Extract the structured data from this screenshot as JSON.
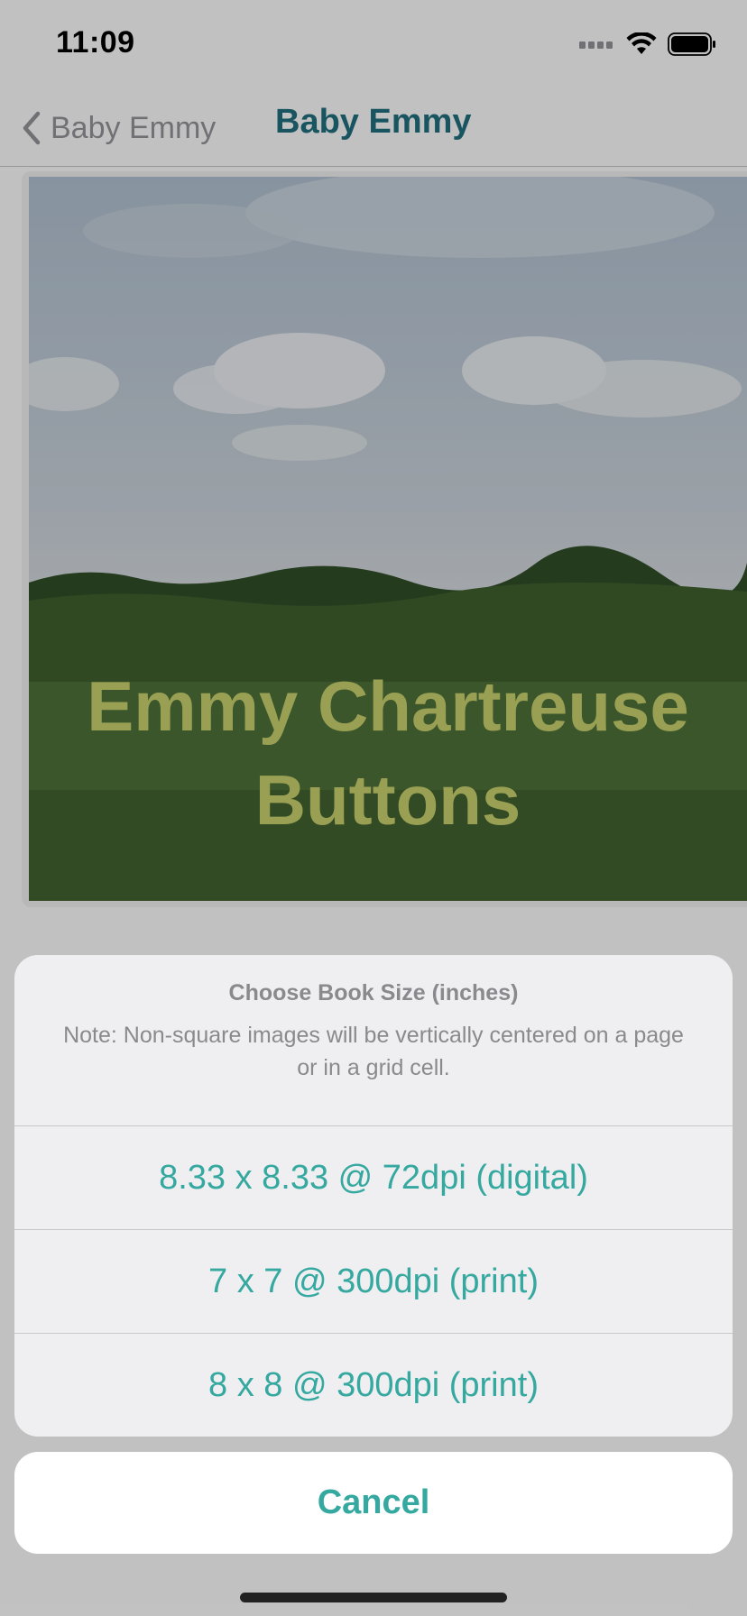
{
  "status_bar": {
    "time": "11:09"
  },
  "nav": {
    "back_label": "Baby Emmy",
    "title": "Baby Emmy"
  },
  "cover": {
    "title": "Emmy Chartreuse Buttons",
    "title_color": "#c0c96a"
  },
  "action_sheet": {
    "title": "Choose Book Size (inches)",
    "message": "Note: Non-square images will be vertically centered on a page or in a grid cell.",
    "options": [
      {
        "label": "8.33 x 8.33 @ 72dpi (digital)"
      },
      {
        "label": "7 x 7 @ 300dpi (print)"
      },
      {
        "label": "8 x 8 @ 300dpi (print)"
      }
    ],
    "cancel_label": "Cancel"
  },
  "colors": {
    "accent": "#35a8a0",
    "nav_title": "#1f6b78"
  },
  "icons": [
    "chevron-left-icon",
    "cellular-signal-icon",
    "wifi-icon",
    "battery-icon"
  ]
}
